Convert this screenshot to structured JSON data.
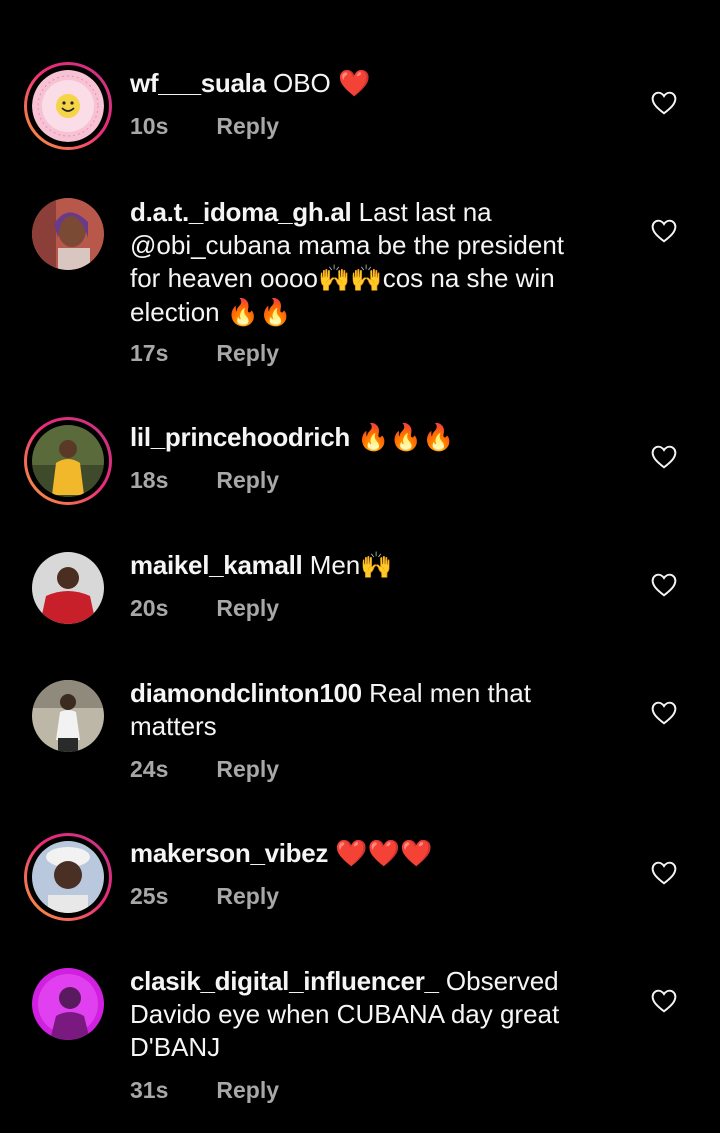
{
  "comments": [
    {
      "username": "wf___suala",
      "text": "OBO ",
      "emoji": "❤️",
      "time": "10s",
      "reply": "Reply"
    },
    {
      "username": "d.a.t._idoma_gh.al",
      "text_lines": [
        "Last last na",
        "@obi_cubana mama be the president",
        "for heaven oooo",
        "cos na she win",
        "election "
      ],
      "emoji_a": "🙌🙌",
      "emoji_b": "🔥🔥",
      "time": "17s",
      "reply": "Reply"
    },
    {
      "username": "lil_princehoodrich",
      "text": " ",
      "emoji": "🔥🔥🔥",
      "time": "18s",
      "reply": "Reply"
    },
    {
      "username": "maikel_kamall",
      "text": "Men",
      "emoji": "🙌",
      "time": "20s",
      "reply": "Reply"
    },
    {
      "username": "diamondclinton100",
      "text_lines": [
        "Real men that",
        "matters"
      ],
      "time": "24s",
      "reply": "Reply"
    },
    {
      "username": "makerson_vibez",
      "text": " ",
      "emoji": "❤️❤️❤️",
      "time": "25s",
      "reply": "Reply"
    },
    {
      "username": "clasik_digital_influencer_",
      "text_lines": [
        "Observed",
        "Davido eye when CUBANA day great",
        "D'BANJ"
      ],
      "time": "31s",
      "reply": "Reply"
    }
  ],
  "icons": {
    "like": "heart-outline-icon"
  },
  "colors": {
    "background": "#000000",
    "text": "#f5f5f5",
    "meta": "#a8a8a8",
    "heart_emoji": "#e0245e",
    "fire": "#ff7a1a"
  }
}
